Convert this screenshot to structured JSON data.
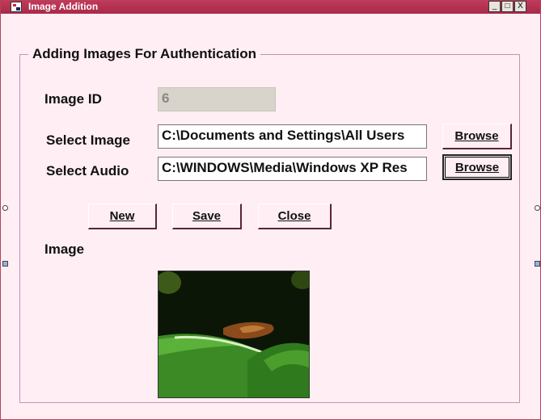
{
  "window": {
    "title": "Image Addition",
    "controls": {
      "minimize": "_",
      "maximize": "□",
      "close": "X"
    }
  },
  "group": {
    "legend": "Adding Images For Authentication"
  },
  "fields": {
    "image_id": {
      "label": "Image ID",
      "value": "6"
    },
    "select_image": {
      "label": "Select Image",
      "value": "C:\\Documents and Settings\\All Users"
    },
    "select_audio": {
      "label": "Select Audio",
      "value": "C:\\WINDOWS\\Media\\Windows XP Res"
    }
  },
  "buttons": {
    "browse_image": "Browse",
    "browse_audio": "Browse",
    "new": "New",
    "save": "Save",
    "close": "Close"
  },
  "image_section": {
    "label": "Image"
  },
  "colors": {
    "background": "#ffeef4",
    "titlebar": "#b03050",
    "border_accent": "#5a2434"
  }
}
